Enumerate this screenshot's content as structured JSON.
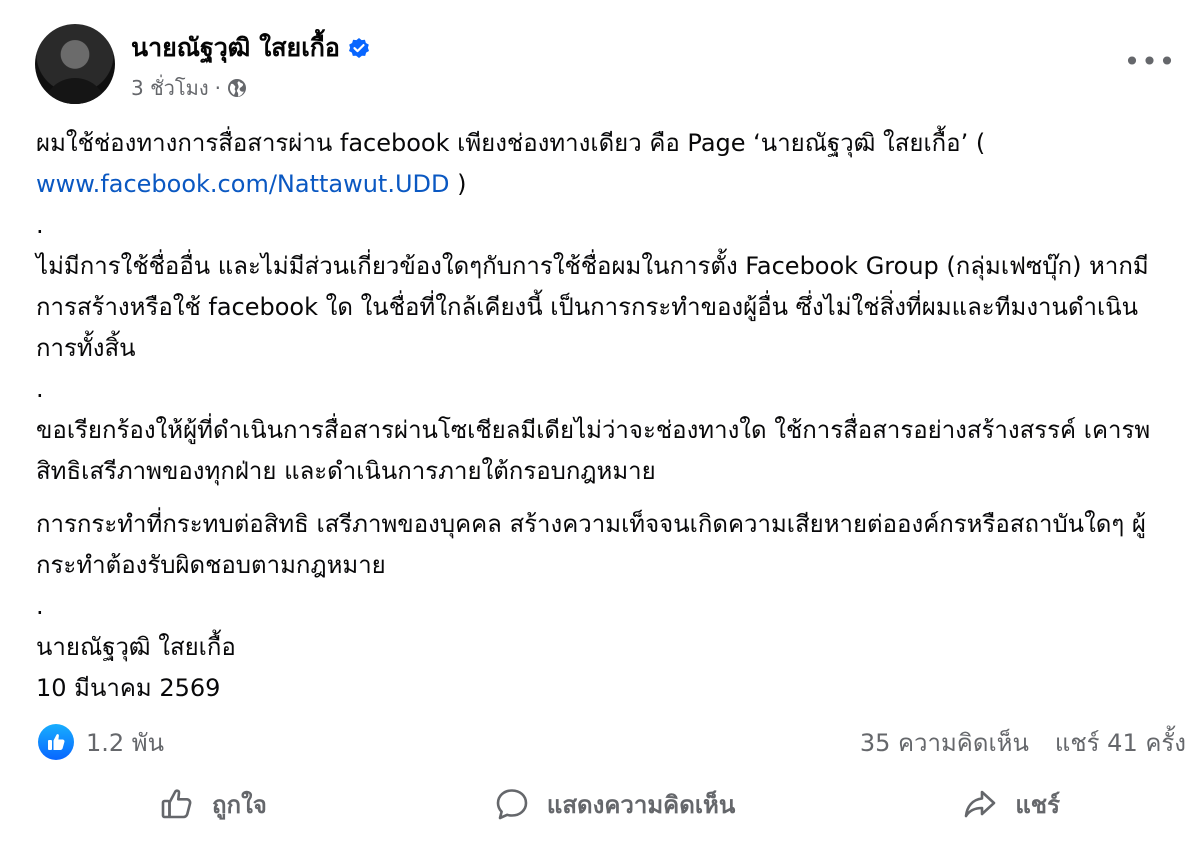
{
  "post": {
    "author": "นายณัฐวุฒิ ใสยเกื้อ",
    "time": "3 ชั่วโมง",
    "separator": "·",
    "body": {
      "p1_text": "ผมใช้ช่องทางการสื่อสารผ่าน facebook เพียงช่องทางเดียว คือ Page ‘นายณัฐวุฒิ ใสยเกื้อ’ (",
      "p1_link": "www.facebook.com/Nattawut.UDD",
      "p1_end": " )",
      "dot1": ".",
      "p2": "ไม่มีการใช้ชื่ออื่น และไม่มีส่วนเกี่ยวข้องใดๆกับการใช้ชื่อผมในการตั้ง Facebook Group (กลุ่มเฟซบุ๊ก) หากมีการสร้างหรือใช้ facebook ใด ในชื่อที่ใกล้เคียงนี้ เป็นการกระทำของผู้อื่น ซึ่งไม่ใช่สิ่งที่ผมและทีมงานดำเนินการทั้งสิ้น",
      "dot2": ".",
      "p3": "ขอเรียกร้องให้ผู้ที่ดำเนินการสื่อสารผ่านโซเชียลมีเดียไม่ว่าจะช่องทางใด ใช้การสื่อสารอย่างสร้างสรรค์ เคารพสิทธิเสรีภาพของทุกฝ่าย และดำเนินการภายใต้กรอบกฎหมาย",
      "p4": "การกระทำที่กระทบต่อสิทธิ เสรีภาพของบุคคล สร้างความเท็จจนเกิดความเสียหายต่อองค์กรหรือสถาบันใดๆ ผู้กระทำต้องรับผิดชอบตามกฎหมาย",
      "dot3": ".",
      "signature": "นายณัฐวุฒิ ใสยเกื้อ",
      "date": "10 มีนาคม 2569"
    },
    "stats": {
      "reactions": "1.2 พัน",
      "comments": "35 ความคิดเห็น",
      "shares": "แชร์ 41 ครั้ง"
    },
    "actions": {
      "like": "ถูกใจ",
      "comment": "แสดงความคิดเห็น",
      "share": "แชร์"
    }
  },
  "icons": {
    "verified": "verified-badge-icon",
    "audience": "globe-icon",
    "more": "more-options-icon",
    "reaction": "like-reaction-icon",
    "like": "thumbs-up-icon",
    "comment": "comment-bubble-icon",
    "share": "share-arrow-icon"
  },
  "colors": {
    "link": "#0a58c2",
    "verified": "#0866ff",
    "secondary_text": "#65676b"
  }
}
